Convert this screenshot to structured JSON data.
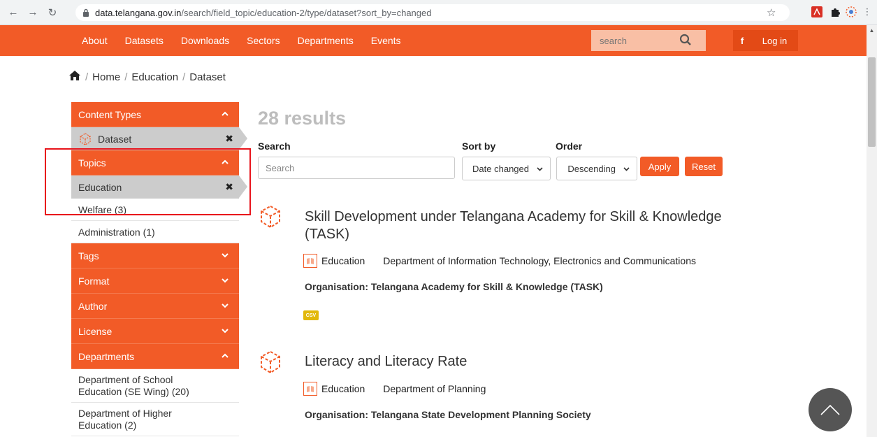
{
  "browser": {
    "url_host": "data.telangana.gov.in",
    "url_path": "/search/field_topic/education-2/type/dataset?sort_by=changed"
  },
  "header": {
    "menu": [
      "About",
      "Datasets",
      "Downloads",
      "Sectors",
      "Departments",
      "Events"
    ],
    "search_placeholder": "search",
    "facebook": "f",
    "login": "Log in"
  },
  "breadcrumb": {
    "home": "Home",
    "education": "Education",
    "dataset": "Dataset"
  },
  "sidebar": {
    "content_types": "Content Types",
    "dataset_active": "Dataset",
    "topics": "Topics",
    "education_active": "Education",
    "welfare": "Welfare (3)",
    "administration": "Administration (1)",
    "tags": "Tags",
    "format": "Format",
    "author": "Author",
    "license": "License",
    "departments": "Departments",
    "dept_school_line1": "Department of School",
    "dept_school_line2": "Education (SE Wing) (20)",
    "dept_higher_line1": "Department of Higher",
    "dept_higher_line2": "Education (2)"
  },
  "main": {
    "results": "28 results",
    "search_label": "Search",
    "search_placeholder": "Search",
    "sortby_label": "Sort by",
    "sortby_value": "Date changed",
    "order_label": "Order",
    "order_value": "Descending",
    "apply": "Apply",
    "reset": "Reset"
  },
  "datasets": [
    {
      "title_line1": "Skill Development under Telangana Academy for Skill & Knowledge",
      "title_line2": "(TASK)",
      "topic": "Education",
      "department": "Department of Information Technology, Electronics and Communications",
      "organisation": "Organisation: Telangana Academy for Skill & Knowledge (TASK)",
      "format": "CSV"
    },
    {
      "title_line1": "Literacy and Literacy Rate",
      "topic": "Education",
      "department": "Department of Planning",
      "organisation": "Organisation: Telangana State Development Planning Society"
    }
  ],
  "colors": {
    "brand_orange": "#f25b27",
    "highlight_red": "#e8141b",
    "csv_badge": "#e2b80a"
  }
}
